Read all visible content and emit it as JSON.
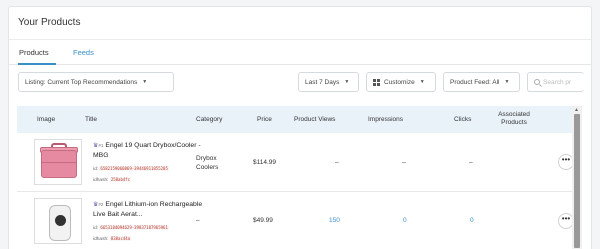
{
  "page": {
    "title": "Your Products"
  },
  "tabs": [
    {
      "label": "Products",
      "active": true
    },
    {
      "label": "Feeds"
    }
  ],
  "toolbar": {
    "listing_label": "Listing: Current Top Recommendations",
    "date_range": "Last 7 Days",
    "customize": "Customize",
    "product_feed": "Product Feed: All",
    "search_placeholder": "Search pr"
  },
  "table": {
    "columns": [
      "Image",
      "Title",
      "Category",
      "Price",
      "Product Views",
      "Impressions",
      "Clicks",
      "Associated Products"
    ],
    "rows": [
      {
        "rank": "#1",
        "title": "Engel 19 Quart Drybox/Cooler - MBG",
        "id_label": "id:",
        "id_value": "6582159060869-39446911855205",
        "idhash_label": "idhash:",
        "idhash_value": "258ab4fc",
        "category": "Drybox Coolers",
        "price": "$114.99",
        "views": "–",
        "impressions": "–",
        "clicks": "–",
        "menu": "•••"
      },
      {
        "rank": "#2",
        "title": "Engel Lithium-ion Rechargeable Live Bait Aerat...",
        "id_label": "id:",
        "id_value": "6653184094629-39837187965961",
        "idhash_label": "idhash:",
        "idhash_value": "838ac44a",
        "category": "–",
        "price": "$49.99",
        "views": "150",
        "impressions": "0",
        "clicks": "0",
        "menu": "•••"
      }
    ]
  },
  "colors": {
    "accent": "#3a8fc7",
    "header_bg": "#e9f2f9",
    "id_code": "#c0392b"
  }
}
